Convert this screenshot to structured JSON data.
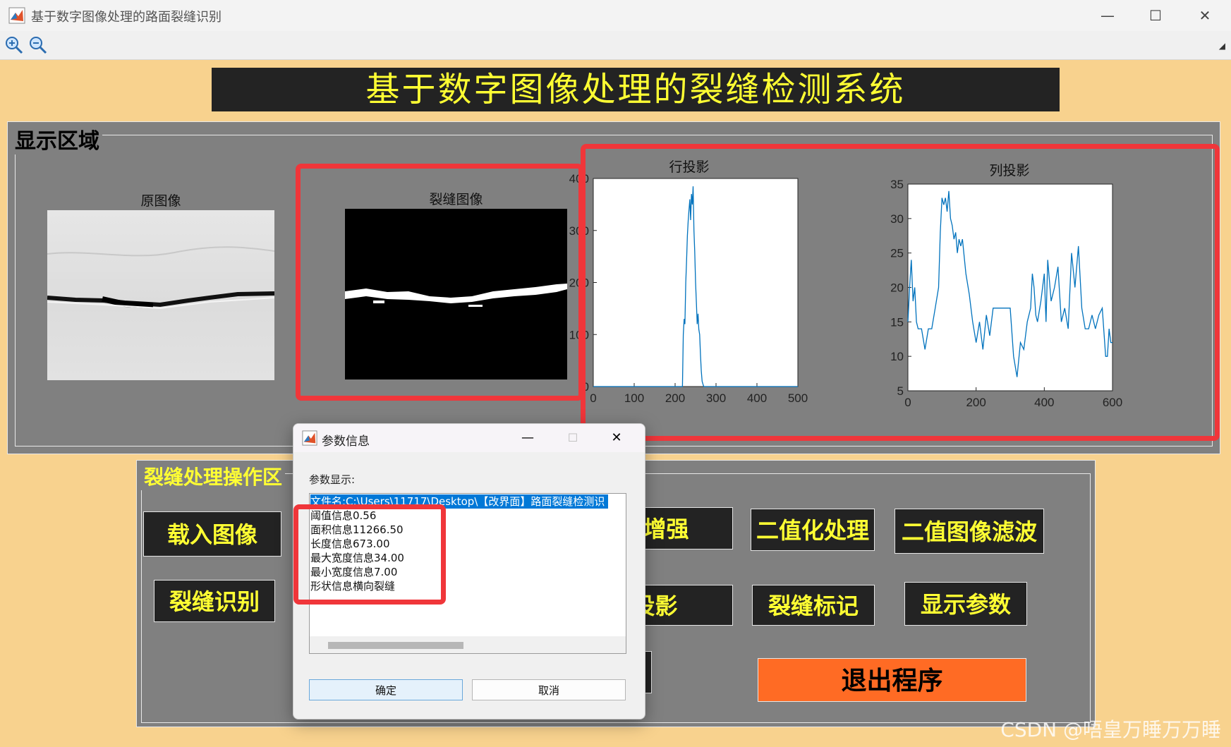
{
  "window": {
    "title": "基于数字图像处理的路面裂缝识别",
    "minimize": "—",
    "maximize": "☐",
    "close": "✕",
    "toolbar_icons": [
      "zoom-in-icon",
      "zoom-out-icon"
    ]
  },
  "banner": {
    "title": "基于数字图像处理的裂缝检测系统"
  },
  "display_panel": {
    "label": "显示区域",
    "original_title": "原图像",
    "crack_title": "裂缝图像"
  },
  "chart_data": [
    {
      "type": "line",
      "title": "行投影",
      "xlim": [
        0,
        500
      ],
      "ylim": [
        0,
        400
      ],
      "xticks": [
        0,
        100,
        200,
        300,
        400,
        500
      ],
      "yticks": [
        0,
        100,
        200,
        300,
        400
      ],
      "series": [
        {
          "color": "#0072bd",
          "x": [
            0,
            218,
            220,
            222,
            224,
            226,
            228,
            230,
            232,
            234,
            236,
            238,
            240,
            242,
            244,
            246,
            248,
            250,
            252,
            254,
            256,
            258,
            260,
            262,
            264,
            266,
            268,
            270,
            272,
            500
          ],
          "y": [
            0,
            0,
            100,
            130,
            120,
            200,
            240,
            290,
            320,
            340,
            360,
            320,
            370,
            350,
            385,
            300,
            260,
            200,
            160,
            120,
            140,
            110,
            100,
            60,
            30,
            10,
            5,
            0,
            0,
            0
          ]
        }
      ]
    },
    {
      "type": "line",
      "title": "列投影",
      "xlim": [
        0,
        600
      ],
      "ylim": [
        5,
        35
      ],
      "xticks": [
        0,
        200,
        400,
        600
      ],
      "yticks": [
        5,
        10,
        15,
        20,
        25,
        30,
        35
      ],
      "series": [
        {
          "color": "#0072bd",
          "x": [
            0,
            5,
            10,
            15,
            20,
            25,
            30,
            40,
            50,
            60,
            70,
            80,
            90,
            95,
            100,
            105,
            110,
            115,
            120,
            125,
            130,
            135,
            140,
            145,
            150,
            155,
            160,
            170,
            180,
            190,
            200,
            210,
            220,
            230,
            240,
            250,
            260,
            270,
            280,
            290,
            300,
            310,
            320,
            330,
            340,
            350,
            360,
            365,
            370,
            375,
            380,
            390,
            400,
            405,
            410,
            420,
            430,
            440,
            450,
            460,
            470,
            480,
            490,
            500,
            510,
            520,
            530,
            540,
            550,
            560,
            570,
            580,
            585,
            590,
            595,
            600
          ],
          "y": [
            15,
            20,
            24,
            18,
            20,
            15,
            14,
            14,
            11,
            14,
            14,
            17,
            20,
            28,
            33,
            32,
            33,
            31,
            34,
            30,
            29,
            27,
            28,
            25,
            27,
            26,
            27,
            22,
            19,
            15,
            12,
            15,
            11,
            16,
            13,
            17,
            17,
            17,
            17,
            17,
            17,
            10,
            7,
            12,
            11,
            15,
            17,
            22,
            20,
            16,
            15,
            18,
            22,
            15,
            24,
            18,
            20,
            23,
            15,
            17,
            14,
            25,
            20,
            26,
            17,
            14,
            14,
            16,
            14,
            16,
            17,
            10,
            10,
            14,
            12,
            12
          ]
        }
      ]
    }
  ],
  "ops_panel": {
    "label": "裂缝处理操作区",
    "buttons": {
      "load": "载入图像",
      "contrast": "对比度增强",
      "binarize": "二值化处理",
      "filter": "二值图像滤波",
      "recognize": "裂缝识别",
      "projection": "裂缝投影",
      "mark": "裂缝标记",
      "show_params": "显示参数",
      "exit": "退出程序"
    },
    "colors": {
      "button_bg": "#232323",
      "button_text": "#ffff33",
      "exit_bg": "#ff6b24"
    }
  },
  "dialog": {
    "title": "参数信息",
    "subtitle": "参数显示:",
    "items": [
      "文件名:C:\\Users\\11717\\Desktop\\【改界面】路面裂缝检测识",
      "阈值信息0.56",
      "面积信息11266.50",
      "长度信息673.00",
      "最大宽度信息34.00",
      "最小宽度信息7.00",
      "形状信息横向裂缝"
    ],
    "ok": "确定",
    "cancel": "取消"
  },
  "watermark": "CSDN @唔皇万睡万万睡"
}
